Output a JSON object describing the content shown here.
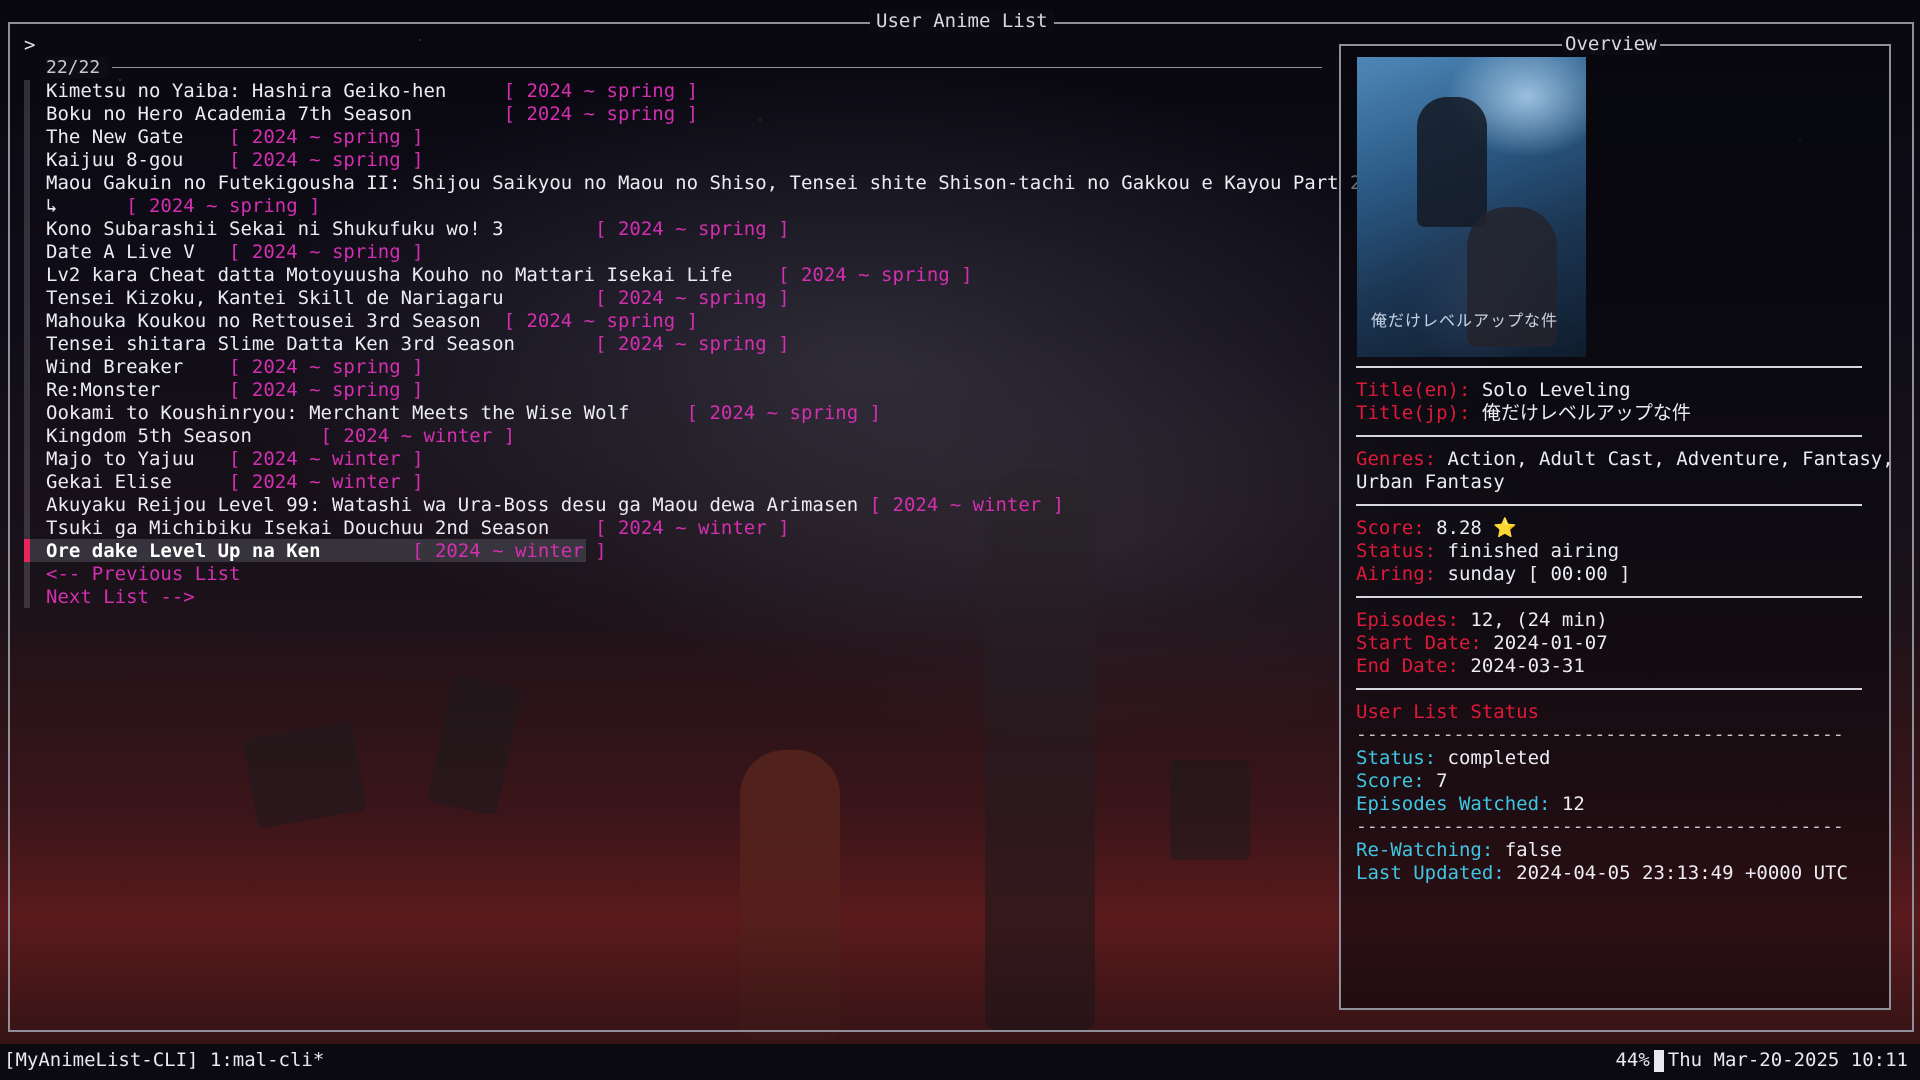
{
  "window": {
    "title": "User Anime List",
    "prompt": ">",
    "count": "22/22"
  },
  "list": [
    {
      "name": "Kimetsu no Yaiba: Hashira Geiko-hen",
      "pad": "     ",
      "season": "[ 2024 ~ spring ]"
    },
    {
      "name": "Boku no Hero Academia 7th Season",
      "pad": "        ",
      "season": "[ 2024 ~ spring ]"
    },
    {
      "name": "The New Gate",
      "pad": "    ",
      "season": "[ 2024 ~ spring ]"
    },
    {
      "name": "Kaijuu 8-gou",
      "pad": "    ",
      "season": "[ 2024 ~ spring ]"
    },
    {
      "name": "Maou Gakuin no Futekigousha II: Shijou Saikyou no Maou no Shiso, Tensei shite Shison-tachi no Gakkou e Kayou Part 2",
      "pad": "",
      "season": ""
    },
    {
      "name": "↳",
      "pad": "      ",
      "season": "[ 2024 ~ spring ]"
    },
    {
      "name": "Kono Subarashii Sekai ni Shukufuku wo! 3",
      "pad": "        ",
      "season": "[ 2024 ~ spring ]"
    },
    {
      "name": "Date A Live V",
      "pad": "   ",
      "season": "[ 2024 ~ spring ]"
    },
    {
      "name": "Lv2 kara Cheat datta Motoyuusha Kouho no Mattari Isekai Life",
      "pad": "    ",
      "season": "[ 2024 ~ spring ]"
    },
    {
      "name": "Tensei Kizoku, Kantei Skill de Nariagaru",
      "pad": "        ",
      "season": "[ 2024 ~ spring ]"
    },
    {
      "name": "Mahouka Koukou no Rettousei 3rd Season",
      "pad": "  ",
      "season": "[ 2024 ~ spring ]"
    },
    {
      "name": "Tensei shitara Slime Datta Ken 3rd Season",
      "pad": "       ",
      "season": "[ 2024 ~ spring ]"
    },
    {
      "name": "Wind Breaker",
      "pad": "    ",
      "season": "[ 2024 ~ spring ]"
    },
    {
      "name": "Re:Monster",
      "pad": "      ",
      "season": "[ 2024 ~ spring ]"
    },
    {
      "name": "Ookami to Koushinryou: Merchant Meets the Wise Wolf",
      "pad": "     ",
      "season": "[ 2024 ~ spring ]"
    },
    {
      "name": "Kingdom 5th Season",
      "pad": "      ",
      "season": "[ 2024 ~ winter ]"
    },
    {
      "name": "Majo to Yajuu",
      "pad": "   ",
      "season": "[ 2024 ~ winter ]"
    },
    {
      "name": "Gekai Elise",
      "pad": "     ",
      "season": "[ 2024 ~ winter ]"
    },
    {
      "name": "Akuyaku Reijou Level 99: Watashi wa Ura-Boss desu ga Maou dewa Arimasen",
      "pad": " ",
      "season": "[ 2024 ~ winter ]"
    },
    {
      "name": "Tsuki ga Michibiku Isekai Douchuu 2nd Season",
      "pad": "    ",
      "season": "[ 2024 ~ winter ]"
    },
    {
      "name": "Ore dake Level Up na Ken",
      "pad": "        ",
      "season": "[ 2024 ~ winter ]"
    }
  ],
  "nav": {
    "prev": "<-- Previous List",
    "next": "Next List -->"
  },
  "overview": {
    "title": "Overview",
    "poster_text": "俺だけレベルアップな件",
    "title_en_label": "Title(en):",
    "title_en": "Solo Leveling",
    "title_jp_label": "Title(jp):",
    "title_jp": "俺だけレベルアップな件",
    "genres_label": "Genres:",
    "genres_line1": "Action, Adult Cast, Adventure, Fantasy,",
    "genres_line2": "Urban Fantasy",
    "score_label": "Score:",
    "score": "8.28",
    "score_icon": "⭐",
    "status_label": "Status:",
    "status": "finished airing",
    "airing_label": "Airing:",
    "airing": "sunday [ 00:00 ]",
    "episodes_label": "Episodes:",
    "episodes": "12, (24 min)",
    "start_label": "Start Date:",
    "start": "2024-01-07",
    "end_label": "End Date:",
    "end": "2024-03-31",
    "user_status_heading": "User List Status",
    "dashes": "---------------------------------------------",
    "u_status_label": "Status:",
    "u_status": "completed",
    "u_score_label": "Score:",
    "u_score": "7",
    "u_eps_label": "Episodes Watched:",
    "u_eps": "12",
    "rewatch_label": "Re-Watching:",
    "rewatch": "false",
    "updated_label": "Last Updated:",
    "updated": "2024-04-05 23:13:49 +0000 UTC"
  },
  "statusbar": {
    "left": "[MyAnimeList-CLI] 1:mal-cli*",
    "battery": "44%",
    "datetime": "Thu Mar-20-2025 10:11"
  },
  "colors": {
    "season": "#d42fb1",
    "label_red": "#e0193a",
    "label_cyan": "#3fc6e4",
    "selection_marker": "#e8265c"
  }
}
